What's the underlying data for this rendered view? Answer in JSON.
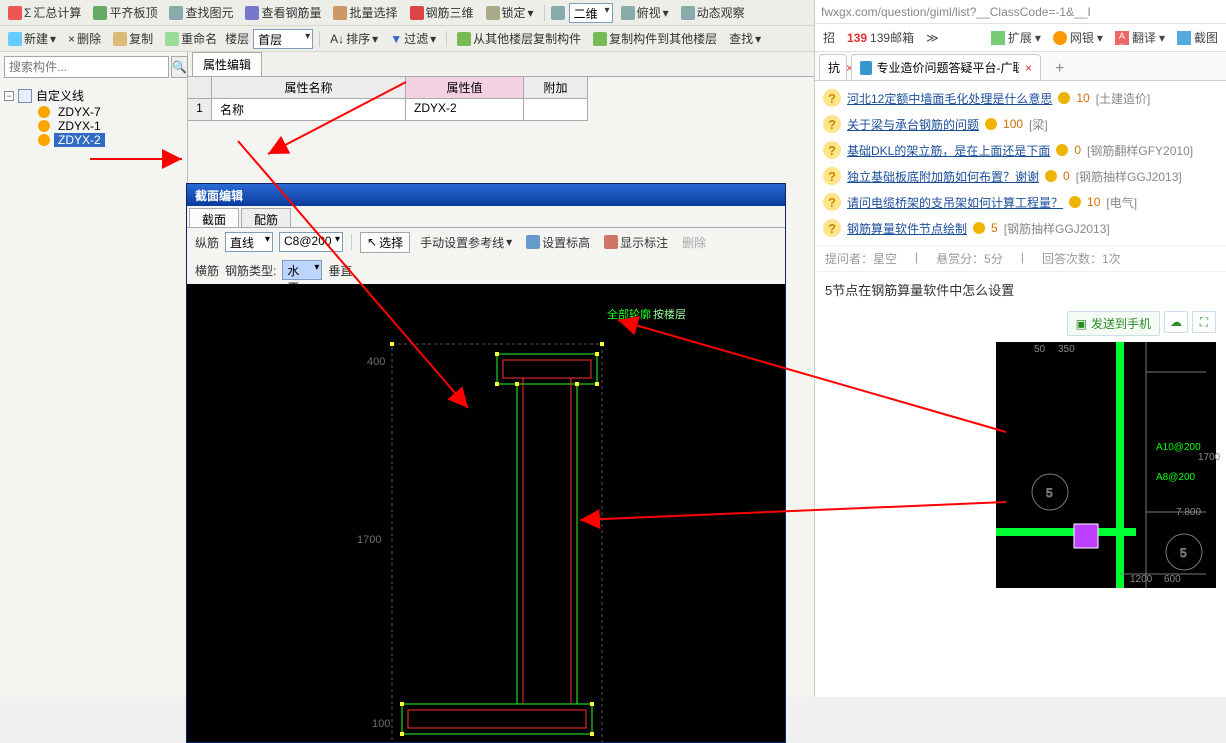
{
  "toolbar1": {
    "sum": "汇总计算",
    "flatten": "平齐板顶",
    "find": "查找图元",
    "rebar": "查看钢筋量",
    "batch": "批量选择",
    "rebar3d": "钢筋三维",
    "lock": "锁定",
    "dim_dd": "二维",
    "side": "俯视",
    "dyn": "动态观察"
  },
  "toolbar2": {
    "new": "新建",
    "del": "删除",
    "copy": "复制",
    "rename": "重命名",
    "floor_lbl": "楼层",
    "floor_val": "首层",
    "sort": "排序",
    "filter": "过滤",
    "copyfrom": "从其他楼层复制构件",
    "copyto": "复制构件到其他楼层",
    "search": "查找"
  },
  "treeSearchPlaceholder": "搜索构件...",
  "tree": {
    "root": "自定义线",
    "children": [
      "ZDYX-7",
      "ZDYX-1",
      "ZDYX-2"
    ]
  },
  "prop": {
    "tab": "属性编辑",
    "h1": "属性名称",
    "h2": "属性值",
    "h3": "附加",
    "r1_name": "名称",
    "r1_val": "ZDYX-2"
  },
  "dlg": {
    "title": "截面编辑",
    "tab1": "截面",
    "tab2": "配筋",
    "row1": {
      "l1": "纵筋",
      "dd1": "直线",
      "dd2": "C8@200",
      "btn1": "选择",
      "btn2": "手动设置参考线",
      "btn3": "设置标高",
      "btn4": "显示标注",
      "btn5": "删除"
    },
    "row2": {
      "l1": "横筋",
      "l2": "钢筋类型:",
      "dd1": "水平",
      "l3": "垂直"
    },
    "canvas": {
      "t1": "全部轮廓",
      "t2": "按楼层",
      "d1": "400",
      "d2": "1700",
      "d3": "100"
    }
  },
  "right": {
    "url": "fwxgx.com/question/giml/list?__ClassCode=-1&__I",
    "tools": {
      "t1": "扩展",
      "t2": "网银",
      "t3": "翻译",
      "t4": "截图"
    },
    "tabLeft": "招",
    "tabMail": "139邮箱",
    "tabChev": "≫",
    "tab1": "抗",
    "tab2": "专业造价问题答疑平台-广联达",
    "qa": [
      {
        "t": "河北12定额中墙面毛化处理是什么意思",
        "n": "10",
        "tag": "[土建造价]"
      },
      {
        "t": "关于梁与承台钢筋的问题",
        "n": "100",
        "tag": "[梁]"
      },
      {
        "t": "基础DKL的架立筋，是在上面还是下面",
        "n": "0",
        "tag": "[钢筋翻样GFY2010]"
      },
      {
        "t": "独立基础板底附加筋如何布置？谢谢",
        "n": "0",
        "tag": "[钢筋抽样GGJ2013]"
      },
      {
        "t": "请问电缆桥架的支吊架如何计算工程量？",
        "n": "10",
        "tag": "[电气]"
      },
      {
        "t": "钢筋算量软件节点绘制",
        "n": "5",
        "tag": "[钢筋抽样GGJ2013]"
      }
    ],
    "meta": {
      "asker": "提问者：星空",
      "reward": "悬赏分：5分",
      "ans": "回答次数：1次"
    },
    "qtitle": "5节点在钢筋算量软件中怎么设置",
    "act": {
      "send": "发送到手机"
    },
    "ref": {
      "a10": "A10@200",
      "a8": "A8@200",
      "d1": "50",
      "d2": "350",
      "d3": "1700",
      "d4": "7.800",
      "d5": "1200",
      "d6": "600",
      "c": "5"
    }
  }
}
